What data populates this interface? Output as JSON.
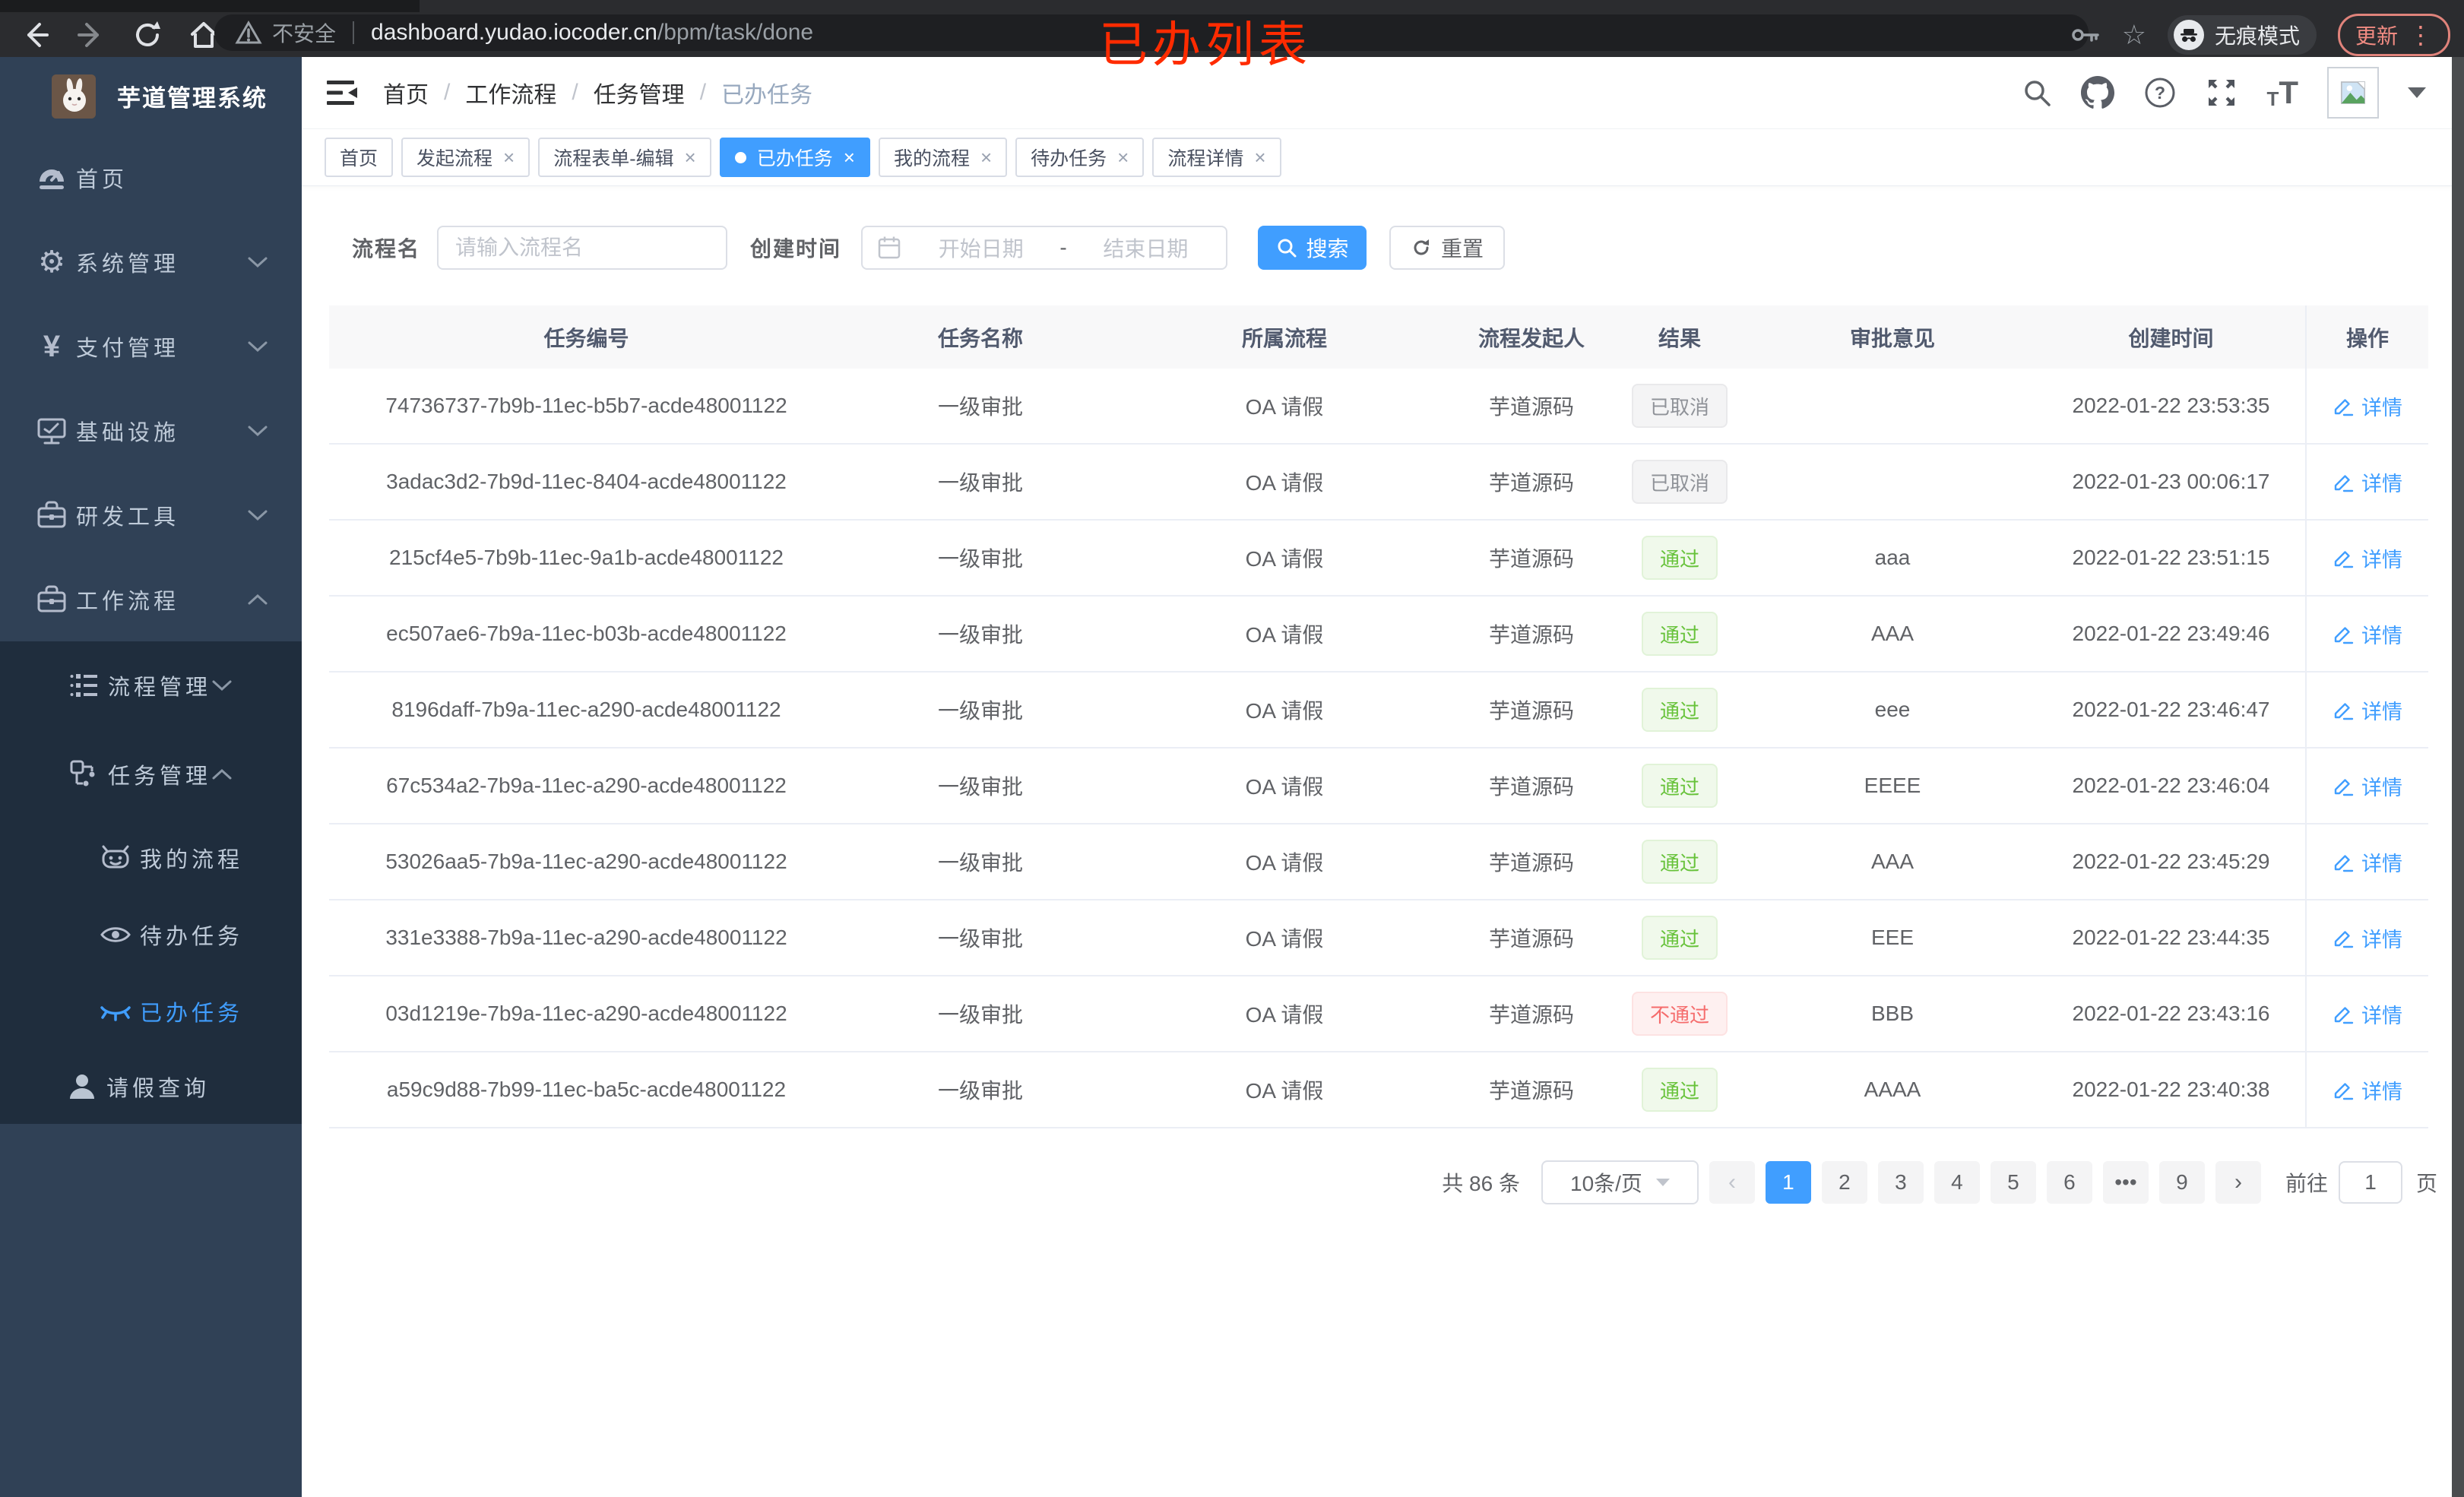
{
  "browser": {
    "security_label": "不安全",
    "url_host": "dashboard.yudao.iocoder.cn",
    "url_path": "/bpm/task/done",
    "incognito_label": "无痕模式",
    "update_label": "更新"
  },
  "annotation": "已办列表",
  "sidebar": {
    "title": "芋道管理系统",
    "menu": [
      {
        "label": "首页"
      },
      {
        "label": "系统管理"
      },
      {
        "label": "支付管理"
      },
      {
        "label": "基础设施"
      },
      {
        "label": "研发工具"
      },
      {
        "label": "工作流程"
      }
    ],
    "process_group": {
      "label": "流程管理"
    },
    "task_group": {
      "label": "任务管理"
    },
    "task_children": [
      {
        "label": "我的流程"
      },
      {
        "label": "待办任务"
      },
      {
        "label": "已办任务"
      }
    ],
    "leave_item": {
      "label": "请假查询"
    }
  },
  "breadcrumb": {
    "items": [
      "首页",
      "工作流程",
      "任务管理",
      "已办任务"
    ]
  },
  "tabs": [
    {
      "label": "首页"
    },
    {
      "label": "发起流程"
    },
    {
      "label": "流程表单-编辑"
    },
    {
      "label": "已办任务"
    },
    {
      "label": "我的流程"
    },
    {
      "label": "待办任务"
    },
    {
      "label": "流程详情"
    }
  ],
  "filters": {
    "name_label": "流程名",
    "name_placeholder": "请输入流程名",
    "date_label": "创建时间",
    "date_start_placeholder": "开始日期",
    "date_separator": "-",
    "date_end_placeholder": "结束日期",
    "search_label": "搜索",
    "reset_label": "重置"
  },
  "table": {
    "columns": [
      "任务编号",
      "任务名称",
      "所属流程",
      "流程发起人",
      "结果",
      "审批意见",
      "创建时间",
      "操作"
    ],
    "action_label": "详情",
    "rows": [
      {
        "id": "74736737-7b9b-11ec-b5b7-acde48001122",
        "name": "一级审批",
        "process": "OA 请假",
        "starter": "芋道源码",
        "result": "已取消",
        "result_type": "info",
        "comment": "",
        "created": "2022-01-22 23:53:35"
      },
      {
        "id": "3adac3d2-7b9d-11ec-8404-acde48001122",
        "name": "一级审批",
        "process": "OA 请假",
        "starter": "芋道源码",
        "result": "已取消",
        "result_type": "info",
        "comment": "",
        "created": "2022-01-23 00:06:17"
      },
      {
        "id": "215cf4e5-7b9b-11ec-9a1b-acde48001122",
        "name": "一级审批",
        "process": "OA 请假",
        "starter": "芋道源码",
        "result": "通过",
        "result_type": "success",
        "comment": "aaa",
        "created": "2022-01-22 23:51:15"
      },
      {
        "id": "ec507ae6-7b9a-11ec-b03b-acde48001122",
        "name": "一级审批",
        "process": "OA 请假",
        "starter": "芋道源码",
        "result": "通过",
        "result_type": "success",
        "comment": "AAA",
        "created": "2022-01-22 23:49:46"
      },
      {
        "id": "8196daff-7b9a-11ec-a290-acde48001122",
        "name": "一级审批",
        "process": "OA 请假",
        "starter": "芋道源码",
        "result": "通过",
        "result_type": "success",
        "comment": "eee",
        "created": "2022-01-22 23:46:47"
      },
      {
        "id": "67c534a2-7b9a-11ec-a290-acde48001122",
        "name": "一级审批",
        "process": "OA 请假",
        "starter": "芋道源码",
        "result": "通过",
        "result_type": "success",
        "comment": "EEEE",
        "created": "2022-01-22 23:46:04"
      },
      {
        "id": "53026aa5-7b9a-11ec-a290-acde48001122",
        "name": "一级审批",
        "process": "OA 请假",
        "starter": "芋道源码",
        "result": "通过",
        "result_type": "success",
        "comment": "AAA",
        "created": "2022-01-22 23:45:29"
      },
      {
        "id": "331e3388-7b9a-11ec-a290-acde48001122",
        "name": "一级审批",
        "process": "OA 请假",
        "starter": "芋道源码",
        "result": "通过",
        "result_type": "success",
        "comment": "EEE",
        "created": "2022-01-22 23:44:35"
      },
      {
        "id": "03d1219e-7b9a-11ec-a290-acde48001122",
        "name": "一级审批",
        "process": "OA 请假",
        "starter": "芋道源码",
        "result": "不通过",
        "result_type": "danger",
        "comment": "BBB",
        "created": "2022-01-22 23:43:16"
      },
      {
        "id": "a59c9d88-7b99-11ec-ba5c-acde48001122",
        "name": "一级审批",
        "process": "OA 请假",
        "starter": "芋道源码",
        "result": "通过",
        "result_type": "success",
        "comment": "AAAA",
        "created": "2022-01-22 23:40:38"
      }
    ]
  },
  "pagination": {
    "total_text": "共 86 条",
    "page_size": "10条/页",
    "pages": [
      "1",
      "2",
      "3",
      "4",
      "5",
      "6",
      "•••",
      "9"
    ],
    "active_page": "1",
    "prev_label": "‹",
    "next_label": "›",
    "goto_label": "前往",
    "goto_value": "1",
    "goto_suffix": "页"
  },
  "colors": {
    "accent": "#409eff",
    "sidebar_bg": "#304156",
    "submenu_bg": "#1f2d3d",
    "success": "#67c23a",
    "danger": "#f56c6c",
    "info": "#909399",
    "annotation_red": "#ff2b00"
  }
}
